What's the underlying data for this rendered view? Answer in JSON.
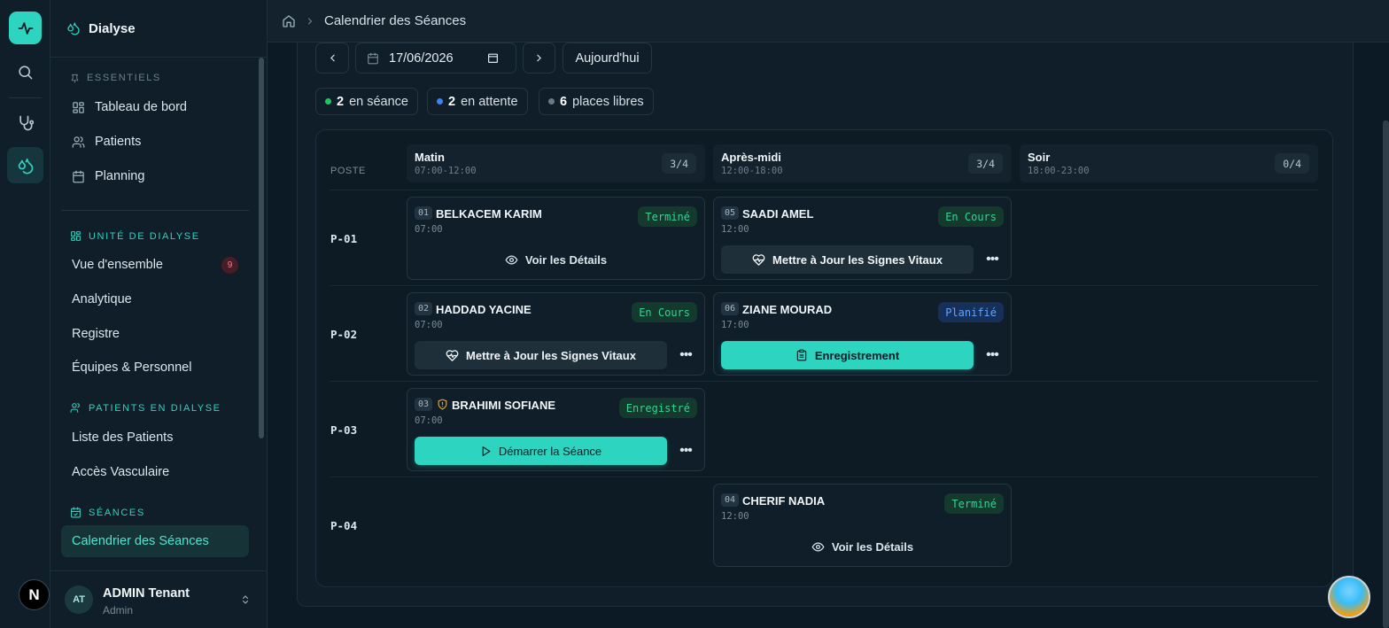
{
  "app": {
    "name": "Dialyse"
  },
  "breadcrumb": {
    "current": "Calendrier des Séances"
  },
  "sidebar": {
    "sections": [
      {
        "label": "ESSENTIELS",
        "items": [
          "Tableau de bord",
          "Patients",
          "Planning"
        ]
      },
      {
        "label": "UNITÉ DE DIALYSE",
        "items": [
          "Vue d'ensemble",
          "Analytique",
          "Registre",
          "Équipes & Personnel"
        ],
        "badge": "9"
      },
      {
        "label": "PATIENTS EN DIALYSE",
        "items": [
          "Liste des Patients",
          "Accès Vasculaire"
        ]
      },
      {
        "label": "SÉANCES",
        "items": [
          "Calendrier des Séances"
        ]
      }
    ],
    "user": {
      "initials": "AT",
      "name": "ADMIN Tenant",
      "role": "Admin"
    }
  },
  "controls": {
    "date": "17/06/2026",
    "today": "Aujourd'hui"
  },
  "summary": [
    {
      "count": "2",
      "label": "en séance",
      "color": "#22c55e"
    },
    {
      "count": "2",
      "label": "en attente",
      "color": "#3b82f6"
    },
    {
      "count": "6",
      "label": "places libres",
      "color": "#6b7a85"
    }
  ],
  "grid": {
    "poste_label": "POSTE",
    "columns": [
      {
        "name": "Matin",
        "time": "07:00-12:00",
        "count": "3/4"
      },
      {
        "name": "Après-midi",
        "time": "12:00-18:00",
        "count": "3/4"
      },
      {
        "name": "Soir",
        "time": "18:00-23:00",
        "count": "0/4"
      }
    ],
    "rows": [
      "P-01",
      "P-02",
      "P-03",
      "P-04"
    ],
    "sessions": [
      {
        "num": "01",
        "name": "BELKACEM KARIM",
        "time": "07:00",
        "status": "Terminé",
        "action": "Voir les Détails"
      },
      {
        "num": "05",
        "name": "SAADI AMEL",
        "time": "12:00",
        "status": "En Cours",
        "action": "Mettre à Jour les Signes Vitaux"
      },
      {
        "num": "02",
        "name": "HADDAD YACINE",
        "time": "07:00",
        "status": "En Cours",
        "action": "Mettre à Jour les Signes Vitaux"
      },
      {
        "num": "06",
        "name": "ZIANE MOURAD",
        "time": "17:00",
        "status": "Planifié",
        "action": "Enregistrement"
      },
      {
        "num": "03",
        "name": "BRAHIMI SOFIANE",
        "time": "07:00",
        "status": "Enregistré",
        "action": "Démarrer la Séance"
      },
      {
        "num": "04",
        "name": "CHERIF NADIA",
        "time": "12:00",
        "status": "Terminé",
        "action": "Voir les Détails"
      }
    ]
  }
}
